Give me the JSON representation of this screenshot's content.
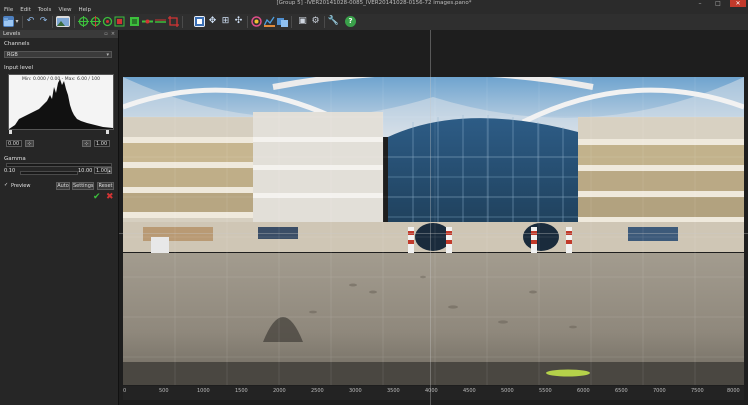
{
  "window": {
    "title": "[Group 5] -IVER20141028-0085_IVER20141028-0156-72 images.pano*",
    "minimize": "–",
    "maximize": "□",
    "close": "✕"
  },
  "menu": [
    "File",
    "Edit",
    "Tools",
    "View",
    "Help"
  ],
  "toolbar": {
    "icons": [
      "open-folder-icon",
      "dropdown-arrow-icon",
      "undo-icon",
      "redo-icon",
      "image-icon",
      "control-points-icon",
      "cp-add-icon",
      "cp-move-icon",
      "mask-icon",
      "optimize-icon",
      "level-icon",
      "horizon-icon",
      "crop-icon",
      "move-icon",
      "zoom-fit-icon",
      "center-icon",
      "color-icon",
      "histogram-icon",
      "blend-icon",
      "render-icon",
      "settings-icon",
      "tools-icon",
      "help-icon"
    ]
  },
  "levels_panel": {
    "title": "Levels",
    "channels_label": "Channels",
    "channel_value": "RGB",
    "input_level_label": "Input level",
    "histogram_caption": "Min: 0.000 / 0.00 - Max: 6.00 / 100",
    "input_min": "0.00",
    "input_max": "1.00",
    "gamma_label": "Gamma",
    "gamma_min": "0.10",
    "gamma_max": "10.00",
    "gamma_value": "1.00",
    "preview_label": "Preview",
    "auto_label": "Auto",
    "settings_label": "Settings",
    "reset_label": "Reset",
    "ok_icon": "checkmark-icon",
    "cancel_icon": "close-icon"
  },
  "ruler": {
    "labels": [
      "0",
      "500",
      "1000",
      "1500",
      "2000",
      "2500",
      "3000",
      "3500",
      "4000",
      "4500",
      "5000",
      "5500",
      "6000",
      "6500",
      "7000",
      "7500",
      "8000"
    ]
  },
  "colors": {
    "accent_green": "#3cbf3c",
    "accent_red": "#d23434",
    "close_red": "#c23a2b"
  }
}
